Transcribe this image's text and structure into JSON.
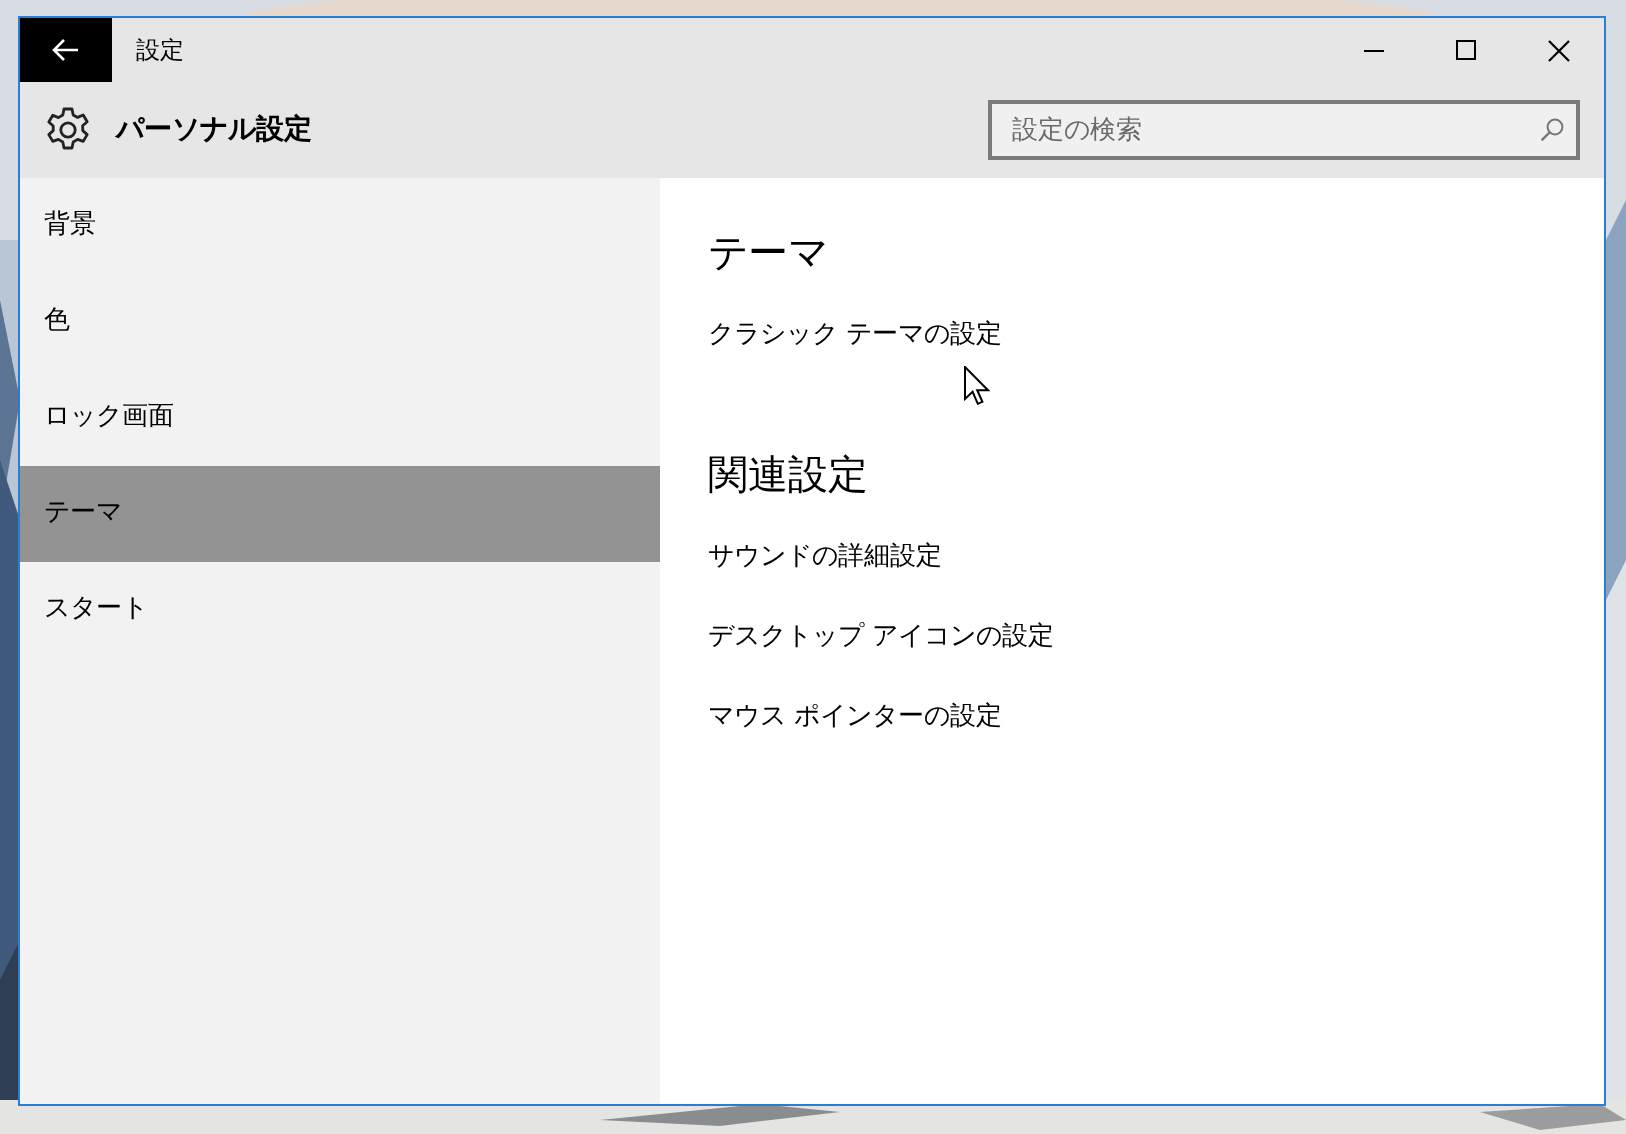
{
  "window": {
    "title": "設定"
  },
  "header": {
    "title": "パーソナル設定"
  },
  "search": {
    "placeholder": "設定の検索"
  },
  "sidebar": {
    "items": [
      {
        "label": "背景",
        "selected": false
      },
      {
        "label": "色",
        "selected": false
      },
      {
        "label": "ロック画面",
        "selected": false
      },
      {
        "label": "テーマ",
        "selected": true
      },
      {
        "label": "スタート",
        "selected": false
      }
    ]
  },
  "sections": [
    {
      "heading": "テーマ",
      "links": [
        "クラシック テーマの設定"
      ]
    },
    {
      "heading": "関連設定",
      "links": [
        "サウンドの詳細設定",
        "デスクトップ アイコンの設定",
        "マウス ポインターの設定"
      ]
    }
  ]
}
